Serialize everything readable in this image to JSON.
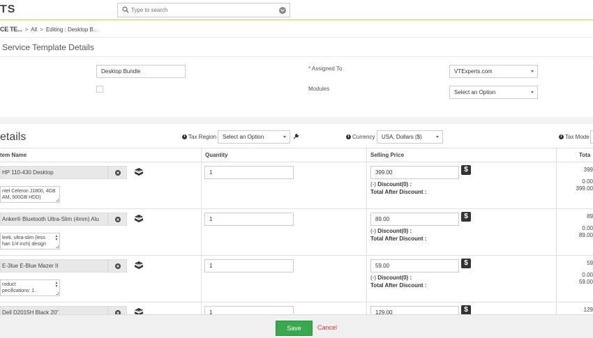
{
  "header": {
    "app_title": "TS",
    "search_placeholder": "Type to search"
  },
  "breadcrumb": {
    "module": "CE TE...",
    "all": "All",
    "current": "Editing : Desktop B.."
  },
  "details_section": {
    "title": "Service Template Details",
    "name_value": "Desktop Bundle",
    "assigned_to_label": "Assigned To",
    "assigned_to_required": "*",
    "assigned_to_value": "VTExperts.com",
    "modules_label": "Modules",
    "modules_value": "Select an Option"
  },
  "items_section": {
    "title": "etails",
    "tax_region_label": "Tax Region",
    "tax_region_value": "Select an Option",
    "currency_label": "Currency",
    "currency_value": "USA, Dollars ($)",
    "tax_mode_label": "Tax Mode",
    "columns": {
      "item_name": "tem Name",
      "quantity": "Quantity",
      "selling_price": "Selling Price",
      "total": "Tota"
    },
    "discount_label": "(-) ",
    "discount_bold": "Discount(0) :",
    "total_after_discount_label": "Total After Discount :",
    "rows": [
      {
        "name": "HP 110-430 Desktop",
        "description": "ntel Celeron J1800, 4GB\nAM, 500GB HDD)",
        "quantity": "1",
        "price": "399.00",
        "total": "399",
        "discount": "0.00",
        "after_discount": "399.00"
      },
      {
        "name": "Anker® Bluetooth Ultra-Slim (4mm) Alu",
        "description": "leek, ultra-slim (less\nhan 1/4 inch) design",
        "quantity": "1",
        "price": "89.00",
        "total": "89",
        "discount": "0.00",
        "after_discount": "89.00"
      },
      {
        "name": "E-3lue E-Blue Mazer II",
        "description": "roduct\npecifications: 1.",
        "quantity": "1",
        "price": "59.00",
        "total": "59",
        "discount": "0.00",
        "after_discount": "59.00"
      },
      {
        "name": "Dell D2015H Black 20\"",
        "description": "",
        "quantity": "1",
        "price": "129.00",
        "total": "129",
        "discount": "",
        "after_discount": ""
      }
    ]
  },
  "footer": {
    "save_label": "Save",
    "cancel_label": "Cancel"
  },
  "colors": {
    "save_green": "#3aa84e",
    "cancel_red": "#dd3333",
    "header_accent": "#f0c040"
  }
}
